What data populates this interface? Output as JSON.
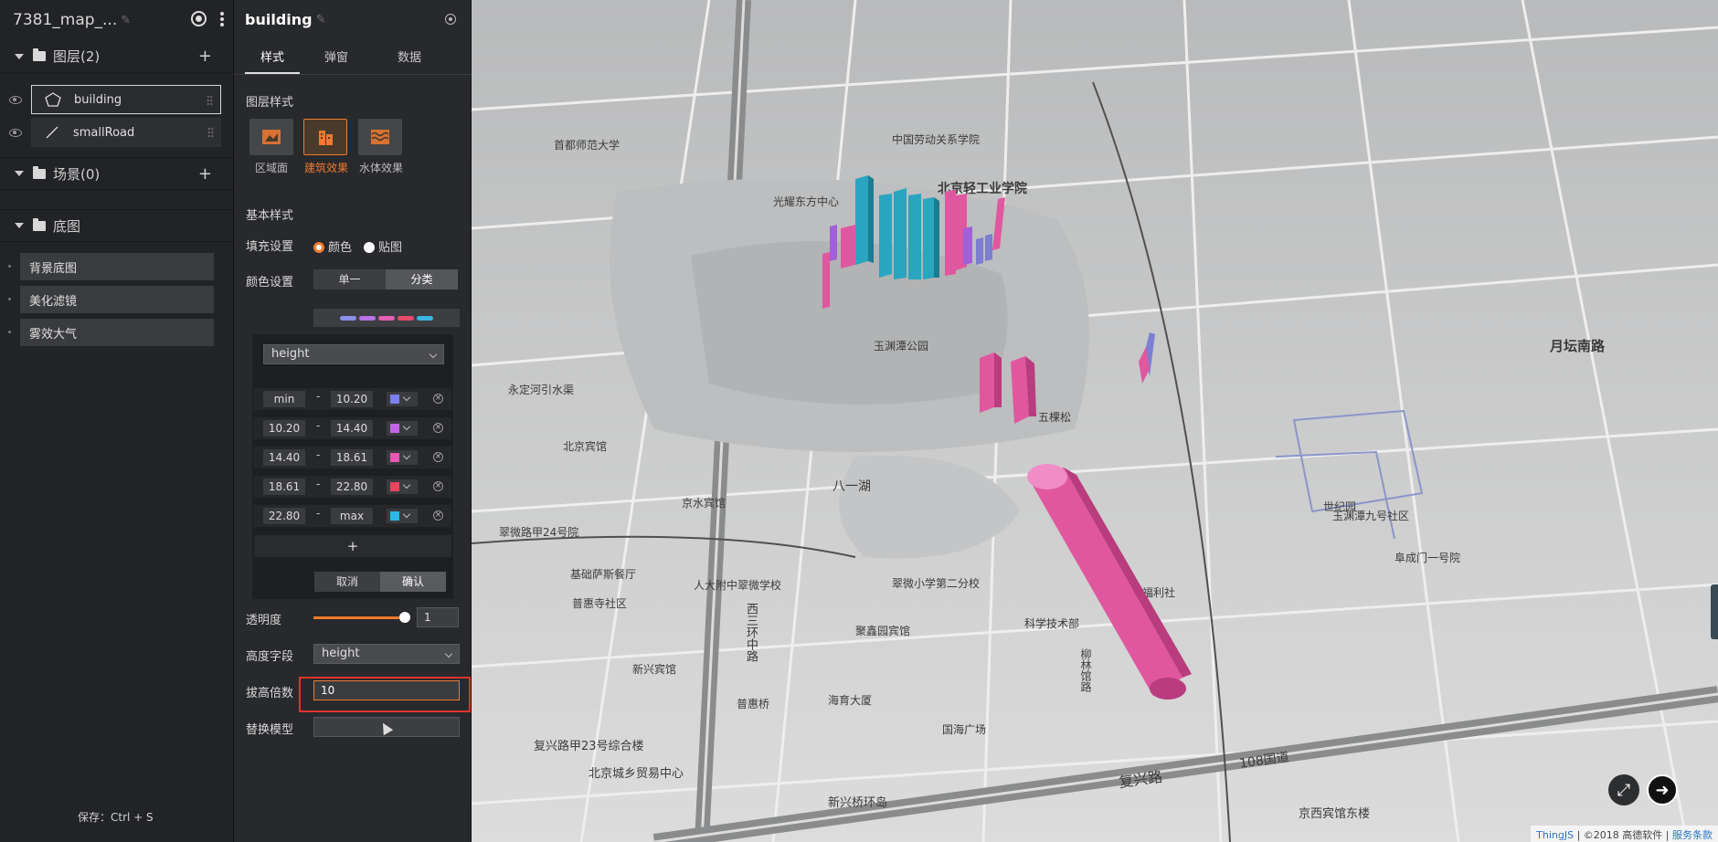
{
  "left_panel": {
    "project_title": "7381_map_...",
    "sections": {
      "layers": {
        "label": "图层(2)",
        "add": "+"
      },
      "scenes": {
        "label": "场景(0)",
        "add": "+"
      },
      "basemap": {
        "label": "底图"
      }
    },
    "layers": [
      {
        "name": "building",
        "icon": "polygon-icon",
        "selected": true
      },
      {
        "name": "smallRoad",
        "icon": "line-icon",
        "selected": false
      }
    ],
    "basemap_items": [
      "背景底图",
      "美化滤镜",
      "雾效大气"
    ],
    "save_hint": "保存：Ctrl + S"
  },
  "props_panel": {
    "title": "building",
    "tabs": [
      "样式",
      "弹窗",
      "数据"
    ],
    "active_tab": 0,
    "layer_style_label": "图层样式",
    "style_options": [
      {
        "label": "区域面",
        "icon": "area-icon",
        "active": false
      },
      {
        "label": "建筑效果",
        "icon": "building-icon",
        "active": true
      },
      {
        "label": "水体效果",
        "icon": "water-icon",
        "active": false
      }
    ],
    "basic_style_label": "基本样式",
    "fill": {
      "label": "填充设置",
      "options": [
        "颜色",
        "贴图"
      ],
      "selected": "颜色"
    },
    "color": {
      "label": "颜色设置",
      "modes": [
        "单一",
        "分类"
      ],
      "selected": "分类"
    },
    "palette_colors": [
      "#8c8fe8",
      "#b873e6",
      "#e05fb0",
      "#e84a6a",
      "#3ab6e0"
    ],
    "classify_field": "height",
    "class_rows": [
      {
        "from": "min",
        "to": "10.20",
        "color": "#7b7ff0"
      },
      {
        "from": "10.20",
        "to": "14.40",
        "color": "#c266e8"
      },
      {
        "from": "14.40",
        "to": "18.61",
        "color": "#e858b4"
      },
      {
        "from": "18.61",
        "to": "22.80",
        "color": "#ee4460"
      },
      {
        "from": "22.80",
        "to": "max",
        "color": "#2fb4e4"
      }
    ],
    "row_separator": "-",
    "remove_symbol": "×",
    "add_row": "+",
    "cancel": "取消",
    "confirm": "确认",
    "opacity": {
      "label": "透明度",
      "value": "1",
      "level": 1
    },
    "height_field": {
      "label": "高度字段",
      "value": "height"
    },
    "height_scale": {
      "label": "拔高倍数",
      "value": "10"
    },
    "replace_model": {
      "label": "替换模型"
    },
    "accent": "#f07a2e"
  },
  "map": {
    "labels": [
      "首都师范大学",
      "中国劳动关系学院",
      "北京轻工业学院",
      "光耀东方中心",
      "八一湖",
      "玉渊潭公园",
      "五棵松",
      "永定河引水渠",
      "北京宾馆",
      "京水宾馆",
      "普惠寺社区",
      "人大附中翠微学校",
      "翠微小学第二分校",
      "聚鑫园宾馆",
      "科学技术部",
      "苹果福利社",
      "新兴宾馆",
      "海育大厦",
      "国海广场",
      "北京城乡贸易中心",
      "新兴桥环岛",
      "复兴路",
      "108国道",
      "西三环中路",
      "普惠桥",
      "柳林馆路",
      "京西宾馆东楼",
      "月坛南路",
      "翠微路甲24号院",
      "基础萨斯餐厅",
      "复兴路甲23号综合楼",
      "世纪园",
      "玉渊潭九号社区",
      "阜成门一号院"
    ],
    "footer": {
      "brand": "ThingJS",
      "copyright": " | ©2018 高德软件 | ",
      "terms": "服务条款"
    }
  }
}
